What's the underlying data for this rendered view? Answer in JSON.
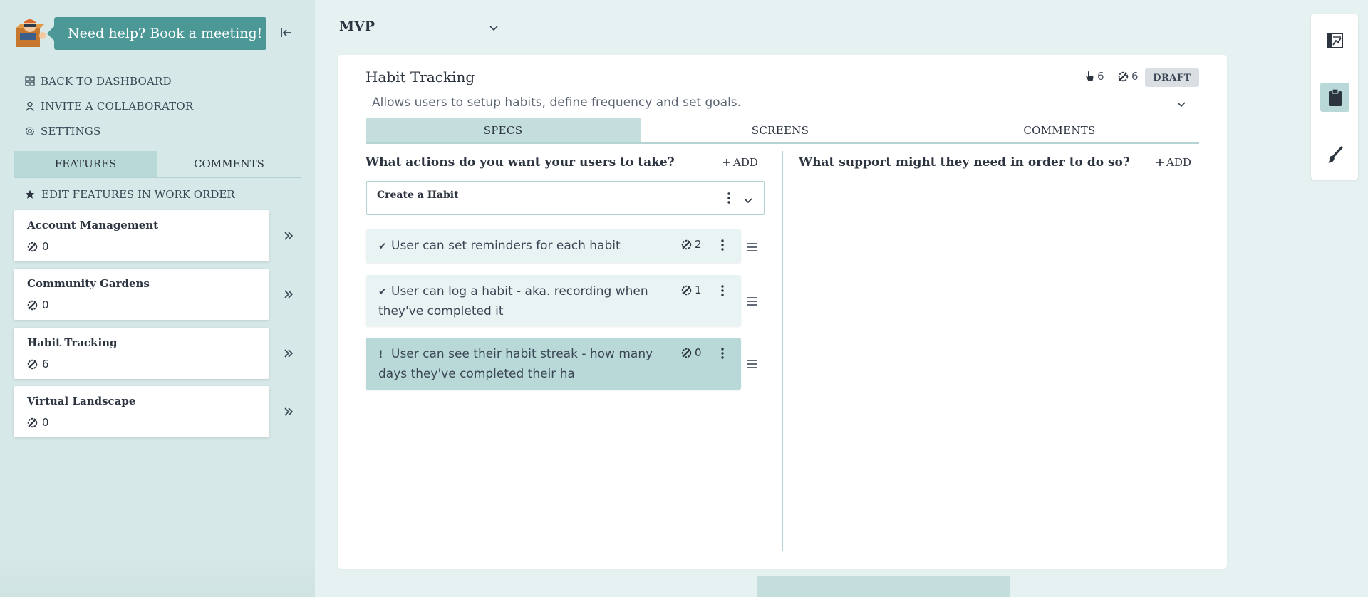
{
  "sidebar": {
    "help_text": "Need help? Book a meeting!",
    "links": {
      "dashboard": "BACK TO DASHBOARD",
      "invite": "INVITE A COLLABORATOR",
      "settings": "SETTINGS"
    },
    "tabs": {
      "features": "FEATURES",
      "comments": "COMMENTS"
    },
    "edit_order": "EDIT FEATURES IN WORK ORDER",
    "features": [
      {
        "name": "Account Management",
        "count": "0"
      },
      {
        "name": "Community Gardens",
        "count": "0"
      },
      {
        "name": "Habit Tracking",
        "count": "6"
      },
      {
        "name": "Virtual Landscape",
        "count": "0"
      }
    ]
  },
  "main": {
    "stage": "MVP",
    "feature": {
      "title": "Habit Tracking",
      "clicks": "6",
      "specs_count": "6",
      "status": "DRAFT",
      "description": "Allows users to setup habits, define frequency and set goals."
    },
    "tabs": {
      "specs": "SPECS",
      "screens": "SCREENS",
      "comments": "COMMENTS"
    },
    "actions": {
      "question": "What actions do you want your users to take?",
      "add_label": "ADD",
      "selected_action": "Create a Habit",
      "specs": [
        {
          "mark": "✔",
          "text": "User can set reminders for each habit",
          "count": "2"
        },
        {
          "mark": "✔",
          "text": "User can log a habit - aka. recording when they've completed it",
          "count": "1"
        },
        {
          "mark": "!",
          "text": "User can see their habit streak - how many days they've completed their ha",
          "count": "0"
        }
      ]
    },
    "support": {
      "question": "What support might they need in order to do so?",
      "add_label": "ADD"
    }
  },
  "colors": {
    "accent": "#4b9896",
    "active_tab": "#c3dedd",
    "sidebar_bg": "#d6e8e7",
    "page_bg": "#e6f2f1"
  },
  "icons": {
    "logo": "box-character-logo",
    "collapse": "collapse-left-icon",
    "dashboard": "grid-icon",
    "invite": "user-icon",
    "settings": "gear-icon",
    "star": "star-icon",
    "specs": "wrench-gear-icon",
    "clicks": "pointer-icon",
    "toolbar": [
      "blueprint-icon",
      "clipboard-icon",
      "brush-icon"
    ]
  }
}
